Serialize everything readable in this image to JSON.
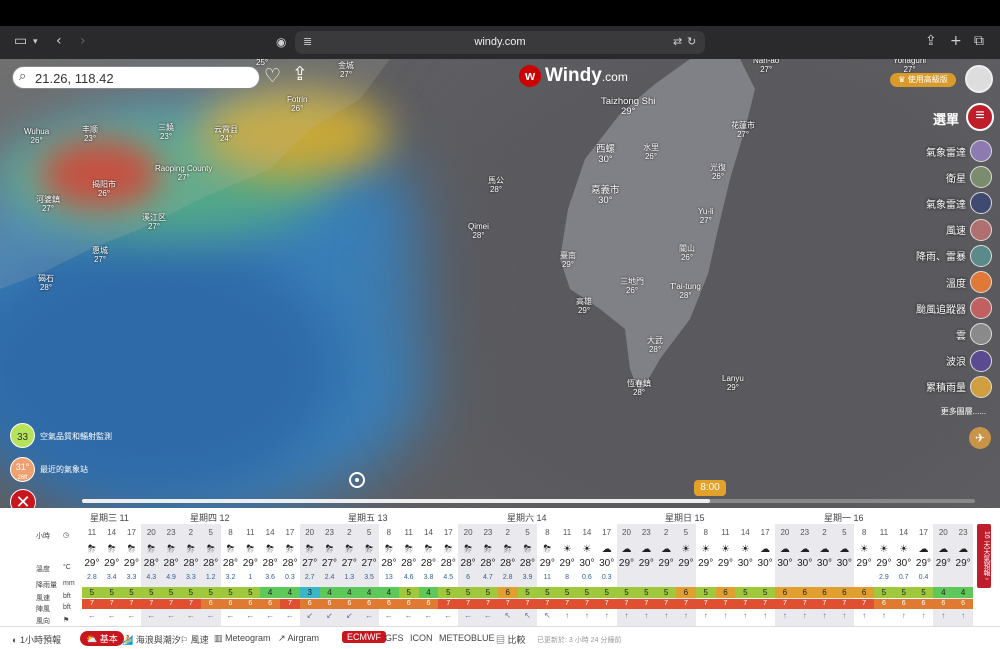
{
  "browser": {
    "url": "windy.com"
  },
  "map": {
    "search": {
      "value": "21.26, 118.42"
    },
    "logo": {
      "name": "Windy",
      "suffix": ".com"
    },
    "premium_label": "♛ 使用高級版",
    "menu_label": "選單",
    "layers": [
      "氣象雷達",
      "衛星",
      "氣象雷達",
      "風速",
      "降雨、雷暴",
      "溫度",
      "颱風追蹤器",
      "雲",
      "波浪",
      "累積雨量"
    ],
    "layer_colors": [
      "#8c7ab0",
      "#7a8c6c",
      "#404a70",
      "#b07070",
      "#5a8a8a",
      "#e07838",
      "#c06060",
      "#8a8a8a",
      "#5a4a90",
      "#d0a040"
    ],
    "more_layers": "更多圖層......",
    "aqi": {
      "value": "33",
      "label": "空氣品質和輻射監測"
    },
    "station": {
      "value": "31°",
      "sub": "26ft",
      "label": "最近的氣象站"
    },
    "cities": [
      {
        "n": "Wuhua",
        "t": "26°"
      },
      {
        "n": "丰顺",
        "t": "23°"
      },
      {
        "n": "三饒",
        "t": "23°"
      },
      {
        "n": "云霄县",
        "t": "24°"
      },
      {
        "n": "揭阳市",
        "t": "26°"
      },
      {
        "n": "河婆鎮",
        "t": "27°"
      },
      {
        "n": "Raoping County",
        "t": "27°"
      },
      {
        "n": "溪江区",
        "t": "27°"
      },
      {
        "n": "惠城",
        "t": "27°"
      },
      {
        "n": "碣石",
        "t": "28°"
      },
      {
        "n": "Fotrin",
        "t": "26°"
      },
      {
        "n": "金城",
        "t": "27°"
      },
      {
        "n": "",
        "t": "25°"
      },
      {
        "n": "",
        "t": "26°"
      },
      {
        "n": "Taizhong Shi",
        "t": "29°"
      },
      {
        "n": "西螺",
        "t": "30°"
      },
      {
        "n": "水里",
        "t": "26°"
      },
      {
        "n": "嘉義市",
        "t": "30°"
      },
      {
        "n": "臺南",
        "t": "29°"
      },
      {
        "n": "高雄",
        "t": "29°"
      },
      {
        "n": "三地門",
        "t": "26°"
      },
      {
        "n": "T'ai-tung",
        "t": "28°"
      },
      {
        "n": "大武",
        "t": "28°"
      },
      {
        "n": "恆春鎮",
        "t": "28°"
      },
      {
        "n": "Lanyu",
        "t": "29°"
      },
      {
        "n": "關山",
        "t": "26°"
      },
      {
        "n": "Yu-li",
        "t": "27°"
      },
      {
        "n": "光復",
        "t": "26°"
      },
      {
        "n": "花蓮市",
        "t": "27°"
      },
      {
        "n": "Nan-ao",
        "t": "27°"
      },
      {
        "n": "Yonaguni",
        "t": "27°"
      },
      {
        "n": "馬公",
        "t": "28°"
      },
      {
        "n": "Qimei",
        "t": "28°"
      }
    ],
    "timeline_label": "8:00"
  },
  "forecast": {
    "days": [
      "星期三 11",
      "星期四 12",
      "星期五 13",
      "星期六 14",
      "星期日 15",
      "星期一 16"
    ],
    "row_labels": {
      "hour": "小時",
      "temp": "溫度",
      "temp_unit": "°C",
      "rain": "降雨量",
      "rain_unit": "mm",
      "wind": "風速",
      "wind_unit": "bft",
      "gust": "陣風",
      "gust_unit": "bft",
      "dir": "風向"
    },
    "hours": [
      "11",
      "14",
      "17",
      "20",
      "23",
      "2",
      "5",
      "8",
      "11",
      "14",
      "17",
      "20",
      "23",
      "2",
      "5",
      "8",
      "11",
      "14",
      "17",
      "20",
      "23",
      "2",
      "5",
      "8",
      "11",
      "14",
      "17",
      "20",
      "23",
      "2",
      "5",
      "8",
      "11",
      "14",
      "17",
      "20",
      "23",
      "2",
      "5",
      "8",
      "11",
      "14",
      "17",
      "20",
      "23"
    ],
    "night": [
      false,
      false,
      false,
      true,
      true,
      true,
      true,
      false,
      false,
      false,
      false,
      true,
      true,
      true,
      true,
      false,
      false,
      false,
      false,
      true,
      true,
      true,
      true,
      false,
      false,
      false,
      false,
      true,
      true,
      true,
      true,
      false,
      false,
      false,
      false,
      true,
      true,
      true,
      true,
      false,
      false,
      false,
      false,
      true,
      true
    ],
    "wx": [
      "⛈",
      "⛈",
      "⛈",
      "⛈",
      "⛈",
      "⛈",
      "⛈",
      "⛈",
      "⛈",
      "⛈",
      "⛈",
      "⛈",
      "⛈",
      "⛈",
      "⛈",
      "⛈",
      "⛈",
      "⛈",
      "⛈",
      "⛈",
      "⛈",
      "⛈",
      "⛈",
      "⛈",
      "☀",
      "☀",
      "☁",
      "☁",
      "☁",
      "☁",
      "☀",
      "☀",
      "☀",
      "☀",
      "☁",
      "☁",
      "☁",
      "☁",
      "☁",
      "☀",
      "☀",
      "☀",
      "☁",
      "☁",
      "☁"
    ],
    "temps": [
      "29°",
      "29°",
      "29°",
      "28°",
      "28°",
      "28°",
      "28°",
      "28°",
      "29°",
      "28°",
      "28°",
      "27°",
      "27°",
      "27°",
      "27°",
      "28°",
      "28°",
      "28°",
      "28°",
      "28°",
      "28°",
      "28°",
      "28°",
      "29°",
      "29°",
      "30°",
      "30°",
      "29°",
      "29°",
      "29°",
      "29°",
      "29°",
      "29°",
      "30°",
      "30°",
      "30°",
      "30°",
      "30°",
      "30°",
      "29°",
      "29°",
      "30°",
      "29°",
      "29°",
      "29°"
    ],
    "rain": [
      "2.8",
      "3.4",
      "3.3",
      "4.3",
      "4.9",
      "3.3",
      "1.2",
      "3.2",
      "1",
      "3.6",
      "0.3",
      "2.7",
      "2.4",
      "1.3",
      "3.5",
      "13",
      "4.6",
      "3.8",
      "4.5",
      "6",
      "4.7",
      "2.8",
      "3.9",
      "11",
      "8",
      "0.6",
      "0.3",
      "",
      "",
      "",
      "",
      "",
      "",
      "",
      "",
      "",
      "",
      "",
      "",
      "",
      "2.9",
      "0.7",
      "0.4",
      "",
      ""
    ],
    "wind": [
      "5",
      "5",
      "5",
      "5",
      "5",
      "5",
      "5",
      "5",
      "5",
      "4",
      "4",
      "3",
      "4",
      "4",
      "4",
      "4",
      "5",
      "4",
      "5",
      "5",
      "5",
      "6",
      "5",
      "5",
      "5",
      "5",
      "5",
      "5",
      "5",
      "5",
      "6",
      "5",
      "6",
      "5",
      "5",
      "6",
      "6",
      "6",
      "6",
      "6",
      "5",
      "5",
      "5",
      "4",
      "4"
    ],
    "gust": [
      "7",
      "7",
      "7",
      "7",
      "7",
      "7",
      "6",
      "6",
      "6",
      "6",
      "7",
      "6",
      "6",
      "6",
      "6",
      "6",
      "6",
      "6",
      "7",
      "7",
      "7",
      "7",
      "7",
      "7",
      "7",
      "7",
      "7",
      "7",
      "7",
      "7",
      "7",
      "7",
      "7",
      "7",
      "7",
      "7",
      "7",
      "7",
      "7",
      "7",
      "6",
      "6",
      "6",
      "6",
      "6"
    ],
    "dirs": [
      "←",
      "←",
      "←",
      "←",
      "←",
      "←",
      "←",
      "←",
      "←",
      "←",
      "←",
      "↙",
      "↙",
      "↙",
      "←",
      "←",
      "←",
      "←",
      "←",
      "←",
      "←",
      "↖",
      "↖",
      "↖",
      "↑",
      "↑",
      "↑",
      "↑",
      "↑",
      "↑",
      "↑",
      "↑",
      "↑",
      "↑",
      "↑",
      "↑",
      "↑",
      "↑",
      "↑",
      "↑",
      "↑",
      "↑",
      "↑",
      "↑",
      "↑"
    ],
    "tab16": "16 天天氣預報 ›"
  },
  "bottom": {
    "items": [
      "1小時預報",
      "基本",
      "海浪與潮汐",
      "風速",
      "Meteogram",
      "Airgram",
      "ECMWF",
      "GFS",
      "ICON",
      "METEOBLUE",
      "比較",
      "已更新於: 3 小時 24 分鐘前"
    ]
  }
}
